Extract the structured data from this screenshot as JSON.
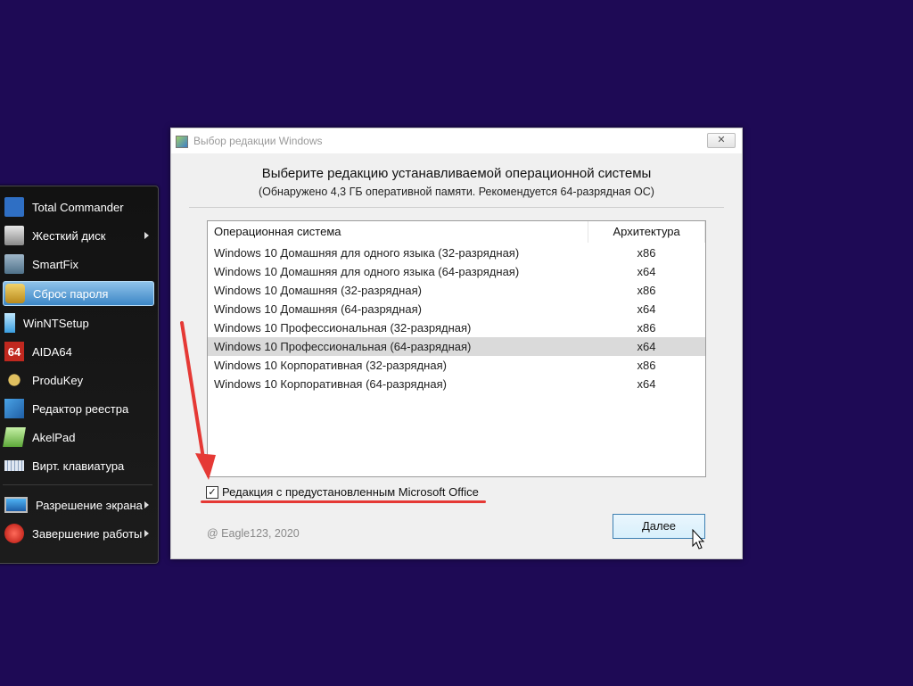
{
  "launcher": {
    "items": [
      {
        "label": "Total Commander",
        "icon": "floppy-disk-icon",
        "has_submenu": false
      },
      {
        "label": "Жесткий диск",
        "icon": "hard-disk-tools-icon",
        "has_submenu": true
      },
      {
        "label": "SmartFix",
        "icon": "smartfix-icon",
        "has_submenu": false
      },
      {
        "label": "Сброс пароля",
        "icon": "keys-icon",
        "has_submenu": false,
        "active": true
      },
      {
        "label": "WinNTSetup",
        "icon": "winntsetup-icon",
        "has_submenu": false
      },
      {
        "label": "AIDA64",
        "icon": "aida64-icon",
        "icon_text": "64",
        "has_submenu": false
      },
      {
        "label": "ProduKey",
        "icon": "key-icon",
        "has_submenu": false
      },
      {
        "label": "Редактор реестра",
        "icon": "registry-editor-icon",
        "has_submenu": false
      },
      {
        "label": "AkelPad",
        "icon": "notepad-icon",
        "has_submenu": false
      },
      {
        "label": "Вирт. клавиатура",
        "icon": "keyboard-icon",
        "has_submenu": false
      }
    ],
    "bottom_items": [
      {
        "label": "Разрешение экрана",
        "icon": "monitor-icon",
        "has_submenu": true
      },
      {
        "label": "Завершение работы",
        "icon": "power-icon",
        "has_submenu": true
      }
    ]
  },
  "dialog": {
    "title": "Выбор редакции Windows",
    "close_symbol": "✕",
    "heading": "Выберите редакцию устанавливаемой операционной системы",
    "subheading": "(Обнаружено 4,3 ГБ оперативной памяти. Рекомендуется 64-разрядная ОС)",
    "table": {
      "columns": [
        "Операционная система",
        "Архитектура"
      ],
      "rows": [
        {
          "os": "Windows 10 Домашняя для одного языка (32-разрядная)",
          "arch": "x86"
        },
        {
          "os": "Windows 10 Домашняя для одного языка (64-разрядная)",
          "arch": "x64"
        },
        {
          "os": "Windows 10 Домашняя (32-разрядная)",
          "arch": "x86"
        },
        {
          "os": "Windows 10 Домашняя (64-разрядная)",
          "arch": "x64"
        },
        {
          "os": "Windows 10 Профессиональная (32-разрядная)",
          "arch": "x86"
        },
        {
          "os": "Windows 10 Профессиональная (64-разрядная)",
          "arch": "x64",
          "selected": true
        },
        {
          "os": "Windows 10 Корпоративная (32-разрядная)",
          "arch": "x86"
        },
        {
          "os": "Windows 10 Корпоративная (64-разрядная)",
          "arch": "x64"
        }
      ]
    },
    "office_checkbox": {
      "label": "Редакция с предустановленным Microsoft Office",
      "checked": true,
      "mark": "✓"
    },
    "credit": "@ Eagle123, 2020",
    "next_button": "Далее"
  },
  "colors": {
    "desktop": "#1e0a55",
    "annotation": "#e53935",
    "selection": "#dadada"
  }
}
